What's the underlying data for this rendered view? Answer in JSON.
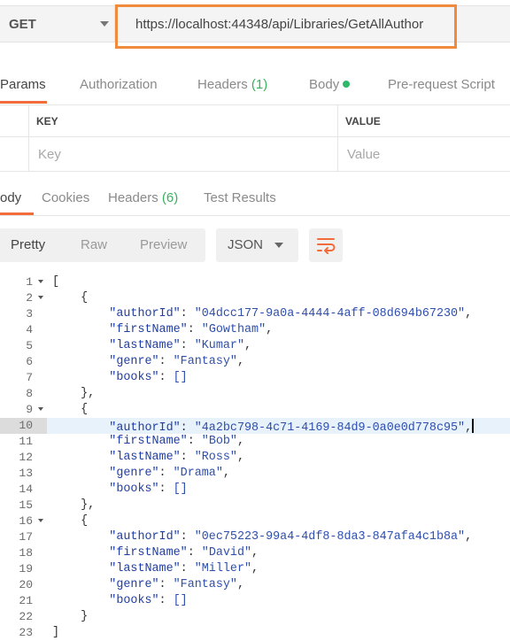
{
  "request": {
    "method": "GET",
    "url": "https://localhost:44348/api/Libraries/GetAllAuthor"
  },
  "request_tabs": {
    "params": "Params",
    "authorization": "Authorization",
    "headers": "Headers",
    "headers_count": "(1)",
    "body": "Body",
    "prerequest": "Pre-request Script"
  },
  "params_table": {
    "key_header": "KEY",
    "value_header": "VALUE",
    "key_placeholder": "Key",
    "value_placeholder": "Value"
  },
  "response_tabs": {
    "body": "ody",
    "cookies": "Cookies",
    "headers": "Headers",
    "headers_count": "(6)",
    "test_results": "Test Results"
  },
  "view_modes": {
    "pretty": "Pretty",
    "raw": "Raw",
    "preview": "Preview",
    "format": "JSON"
  },
  "icons": {
    "method_dropdown": "chevron-down-icon",
    "body_indicator": "green-dot-icon",
    "format_dropdown": "chevron-down-icon",
    "wrap": "wrap-lines-icon"
  },
  "colors": {
    "accent": "#f26b3a",
    "url_highlight": "#f08a3c",
    "count_green": "#3bae5e",
    "json_key": "#1e3ea8",
    "json_string": "#2f4fae",
    "active_line": "#e8f2fb"
  },
  "response": {
    "highlighted_line": 10,
    "lines": [
      {
        "n": "1",
        "fold": true,
        "indent": 0,
        "text": "["
      },
      {
        "n": "2",
        "fold": true,
        "indent": 1,
        "text": "{"
      },
      {
        "n": "3",
        "indent": 2,
        "key": "\"authorId\"",
        "value": "\"04dcc177-9a0a-4444-4aff-08d694b67230\"",
        "end": ","
      },
      {
        "n": "4",
        "indent": 2,
        "key": "\"firstName\"",
        "value": "\"Gowtham\"",
        "end": ","
      },
      {
        "n": "5",
        "indent": 2,
        "key": "\"lastName\"",
        "value": "\"Kumar\"",
        "end": ","
      },
      {
        "n": "6",
        "indent": 2,
        "key": "\"genre\"",
        "value": "\"Fantasy\"",
        "end": ","
      },
      {
        "n": "7",
        "indent": 2,
        "key": "\"books\"",
        "value": "[]",
        "end": ""
      },
      {
        "n": "8",
        "indent": 1,
        "text": "},"
      },
      {
        "n": "9",
        "fold": true,
        "indent": 1,
        "text": "{"
      },
      {
        "n": "10",
        "indent": 2,
        "key": "\"authorId\"",
        "value": "\"4a2bc798-4c71-4169-84d9-0a0e0d778c95\"",
        "end": ","
      },
      {
        "n": "11",
        "indent": 2,
        "key": "\"firstName\"",
        "value": "\"Bob\"",
        "end": ","
      },
      {
        "n": "12",
        "indent": 2,
        "key": "\"lastName\"",
        "value": "\"Ross\"",
        "end": ","
      },
      {
        "n": "13",
        "indent": 2,
        "key": "\"genre\"",
        "value": "\"Drama\"",
        "end": ","
      },
      {
        "n": "14",
        "indent": 2,
        "key": "\"books\"",
        "value": "[]",
        "end": ""
      },
      {
        "n": "15",
        "indent": 1,
        "text": "},"
      },
      {
        "n": "16",
        "fold": true,
        "indent": 1,
        "text": "{"
      },
      {
        "n": "17",
        "indent": 2,
        "key": "\"authorId\"",
        "value": "\"0ec75223-99a4-4df8-8da3-847afa4c1b8a\"",
        "end": ","
      },
      {
        "n": "18",
        "indent": 2,
        "key": "\"firstName\"",
        "value": "\"David\"",
        "end": ","
      },
      {
        "n": "19",
        "indent": 2,
        "key": "\"lastName\"",
        "value": "\"Miller\"",
        "end": ","
      },
      {
        "n": "20",
        "indent": 2,
        "key": "\"genre\"",
        "value": "\"Fantasy\"",
        "end": ","
      },
      {
        "n": "21",
        "indent": 2,
        "key": "\"books\"",
        "value": "[]",
        "end": ""
      },
      {
        "n": "22",
        "indent": 1,
        "text": "}"
      },
      {
        "n": "23",
        "indent": 0,
        "text": "]"
      }
    ]
  }
}
